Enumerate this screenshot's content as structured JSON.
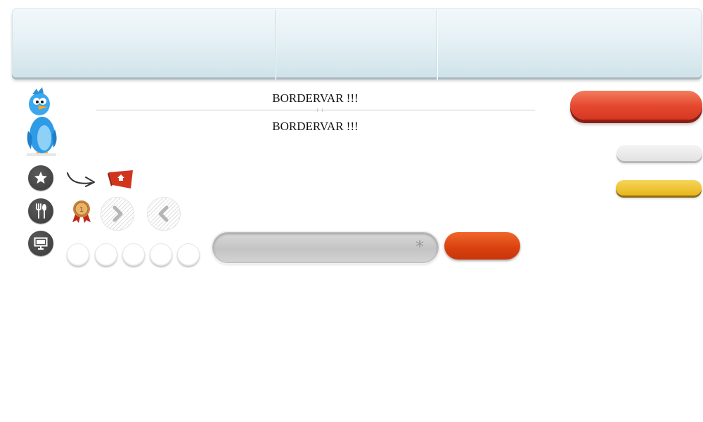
{
  "header": {
    "segments": [
      "",
      "",
      ""
    ]
  },
  "content": {
    "title_top": "BORDERVAR !!!",
    "title_bottom": "BORDERVAR !!!"
  },
  "icons": {
    "mascot": "twitter-bird",
    "left_column": [
      "star-icon",
      "fork-spoon-icon",
      "monitor-icon"
    ],
    "row1": [
      "curved-arrow-icon",
      "home-flag-icon"
    ],
    "row2": [
      "medal-icon",
      "chevron-right-icon",
      "chevron-left-icon"
    ]
  },
  "colors": {
    "red_button": "#e4472e",
    "grey_button": "#e8e8e8",
    "yellow_button": "#efc530",
    "orange_button": "#d9400f",
    "header_bg": "#e6f1f5"
  },
  "search": {
    "value": "",
    "placeholder": "",
    "marker": "*"
  },
  "buttons": {
    "red_label": "",
    "grey_label": "",
    "yellow_label": "",
    "orange_label": ""
  },
  "pager": {
    "count": 5
  }
}
